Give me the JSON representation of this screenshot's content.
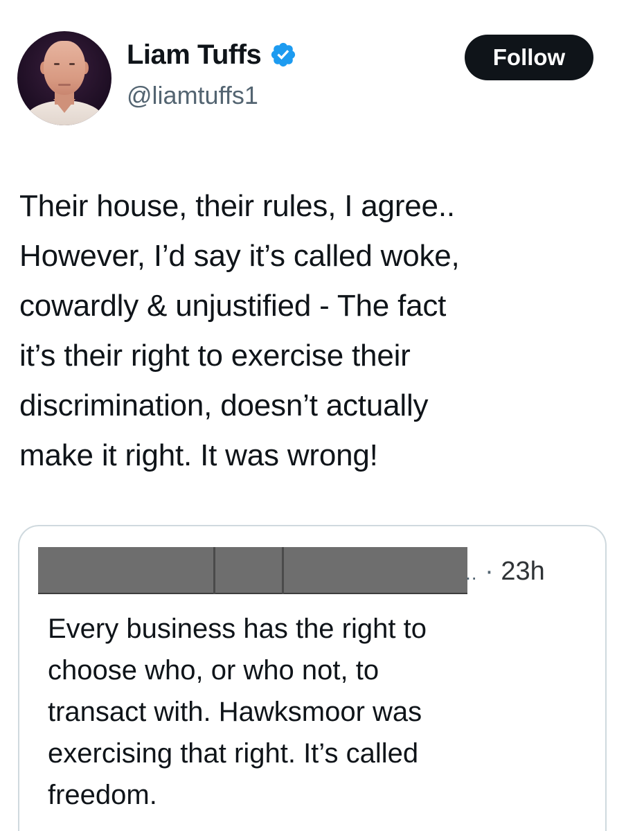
{
  "author": {
    "display_name": "Liam Tuffs",
    "handle": "@liamtuffs1",
    "verified": true,
    "verified_color": "#1d9bf0"
  },
  "actions": {
    "follow_label": "Follow"
  },
  "tweet": {
    "text": "Their house, their rules, I agree..\nHowever, I’d say it’s called woke,\ncowardly & unjustified - The fact\nit’s their right to exercise their\ndiscrimination, doesn’t actually\nmake it right. It was wrong!"
  },
  "quoted_tweet": {
    "author_redacted": true,
    "ellipsis": "..",
    "separator": "·",
    "time": "23h",
    "text": "Every business has the right to\nchoose who, or who not, to\ntransact with. Hawksmoor was\nexercising that right. It’s called\nfreedom."
  },
  "colors": {
    "text_primary": "#0f1419",
    "text_secondary": "#536471",
    "follow_bg": "#0f1419",
    "card_border": "#cfd9de",
    "redaction": "#6e6e6e"
  }
}
